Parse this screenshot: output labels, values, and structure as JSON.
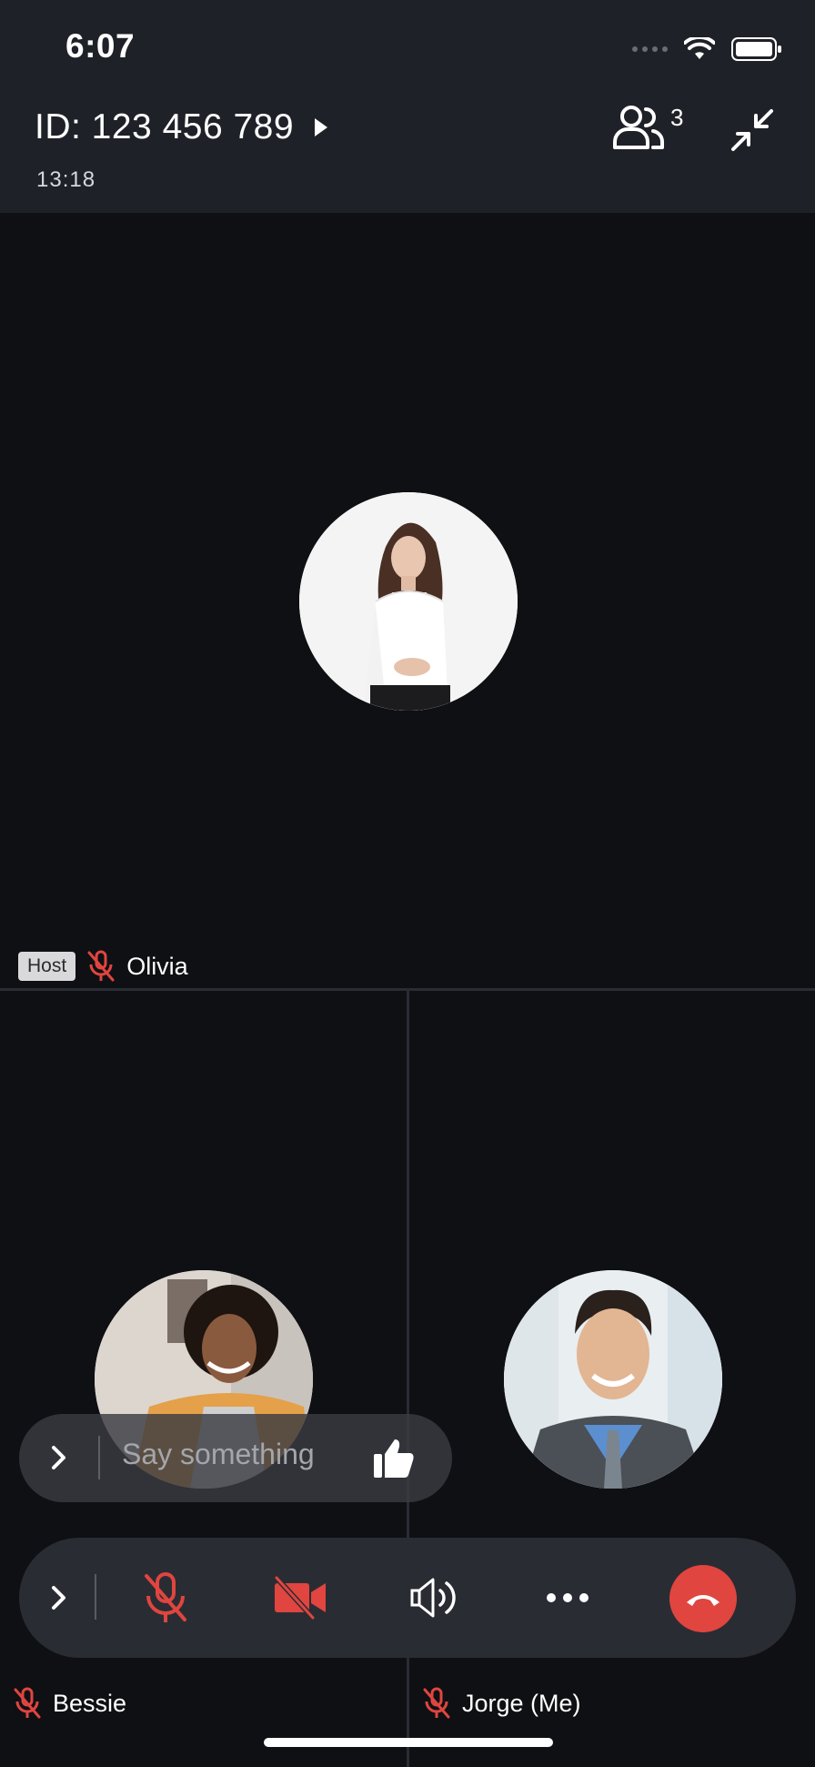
{
  "status_bar": {
    "time": "6:07"
  },
  "header": {
    "meeting_id": "ID: 123 456 789",
    "elapsed": "13:18",
    "participant_count": "3"
  },
  "participants": [
    {
      "name": "Olivia",
      "role_badge": "Host",
      "muted": true
    },
    {
      "name": "Bessie",
      "muted": true
    },
    {
      "name": "Jorge (Me)",
      "muted": true
    }
  ],
  "chat": {
    "placeholder": "Say something"
  },
  "colors": {
    "header_bg": "#1f2128",
    "stage_bg": "#0f1014",
    "muted_red": "#e0453f",
    "end_call": "#e0453f"
  },
  "icons": {
    "participants": "people-icon",
    "minimize": "minimize-arrows-icon",
    "mic": "mic-off-icon",
    "video": "video-off-icon",
    "speaker": "speaker-icon",
    "more": "more-icon",
    "end": "end-call-icon",
    "like": "thumbs-up-icon"
  }
}
